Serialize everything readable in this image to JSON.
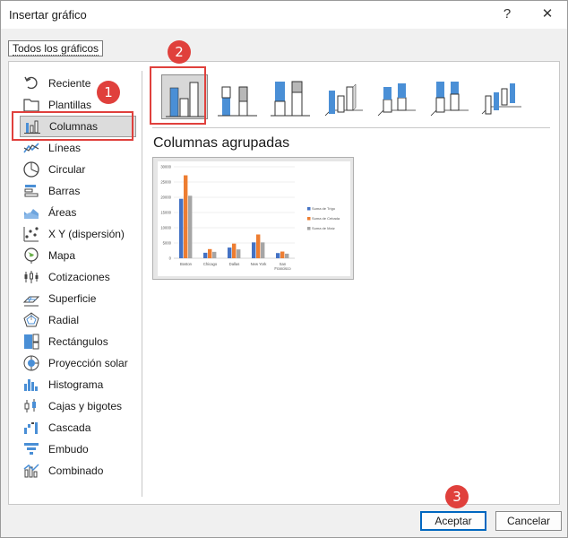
{
  "window": {
    "title": "Insertar gráfico",
    "help_label": "?",
    "close_label": "✕"
  },
  "tab": {
    "label": "Todos los gráficos"
  },
  "chart_types": [
    {
      "label": "Reciente",
      "icon": "recent-icon"
    },
    {
      "label": "Plantillas",
      "icon": "folder-icon"
    },
    {
      "label": "Columnas",
      "icon": "column-chart-icon",
      "selected": true
    },
    {
      "label": "Líneas",
      "icon": "line-chart-icon"
    },
    {
      "label": "Circular",
      "icon": "pie-chart-icon"
    },
    {
      "label": "Barras",
      "icon": "bar-chart-icon"
    },
    {
      "label": "Áreas",
      "icon": "area-chart-icon"
    },
    {
      "label": "X Y (dispersión)",
      "icon": "scatter-chart-icon"
    },
    {
      "label": "Mapa",
      "icon": "map-chart-icon"
    },
    {
      "label": "Cotizaciones",
      "icon": "stock-chart-icon"
    },
    {
      "label": "Superficie",
      "icon": "surface-chart-icon"
    },
    {
      "label": "Radial",
      "icon": "radar-chart-icon"
    },
    {
      "label": "Rectángulos",
      "icon": "treemap-chart-icon"
    },
    {
      "label": "Proyección solar",
      "icon": "sunburst-chart-icon"
    },
    {
      "label": "Histograma",
      "icon": "histogram-chart-icon"
    },
    {
      "label": "Cajas y bigotes",
      "icon": "box-whisker-chart-icon"
    },
    {
      "label": "Cascada",
      "icon": "waterfall-chart-icon"
    },
    {
      "label": "Embudo",
      "icon": "funnel-chart-icon"
    },
    {
      "label": "Combinado",
      "icon": "combo-chart-icon"
    }
  ],
  "subtypes": {
    "selected_title": "Columnas agrupadas",
    "items": [
      {
        "name": "clustered-column-subtype",
        "selected": true
      },
      {
        "name": "stacked-column-subtype"
      },
      {
        "name": "100-stacked-column-subtype"
      },
      {
        "name": "3d-clustered-column-subtype"
      },
      {
        "name": "3d-stacked-column-subtype"
      },
      {
        "name": "3d-100-stacked-column-subtype"
      },
      {
        "name": "3d-column-subtype"
      }
    ]
  },
  "buttons": {
    "accept": "Aceptar",
    "cancel": "Cancelar"
  },
  "callouts": {
    "badge1": "1",
    "badge2": "2",
    "badge3": "3"
  },
  "colors": {
    "accent_red": "#e0403c",
    "series_blue": "#4472c4",
    "series_orange": "#ed7d31",
    "series_gray": "#a5a5a5",
    "icon_blue": "#4a8fd6"
  },
  "chart_data": {
    "type": "bar",
    "categories": [
      "Boston",
      "Chicago",
      "Dallas",
      "New York",
      "San Francisco"
    ],
    "series": [
      {
        "name": "Suma de Trigo",
        "values": [
          19500,
          1800,
          3500,
          5200,
          1700
        ]
      },
      {
        "name": "Suma de Cebada",
        "values": [
          27200,
          3000,
          4800,
          7800,
          2200
        ]
      },
      {
        "name": "Suma de Maíz",
        "values": [
          20500,
          2100,
          2900,
          5200,
          1500
        ]
      }
    ],
    "y_ticks": [
      "0",
      "5000",
      "10000",
      "15000",
      "20000",
      "25000",
      "30000"
    ],
    "ylim": [
      0,
      30000
    ],
    "legend": "right",
    "grid": true
  }
}
